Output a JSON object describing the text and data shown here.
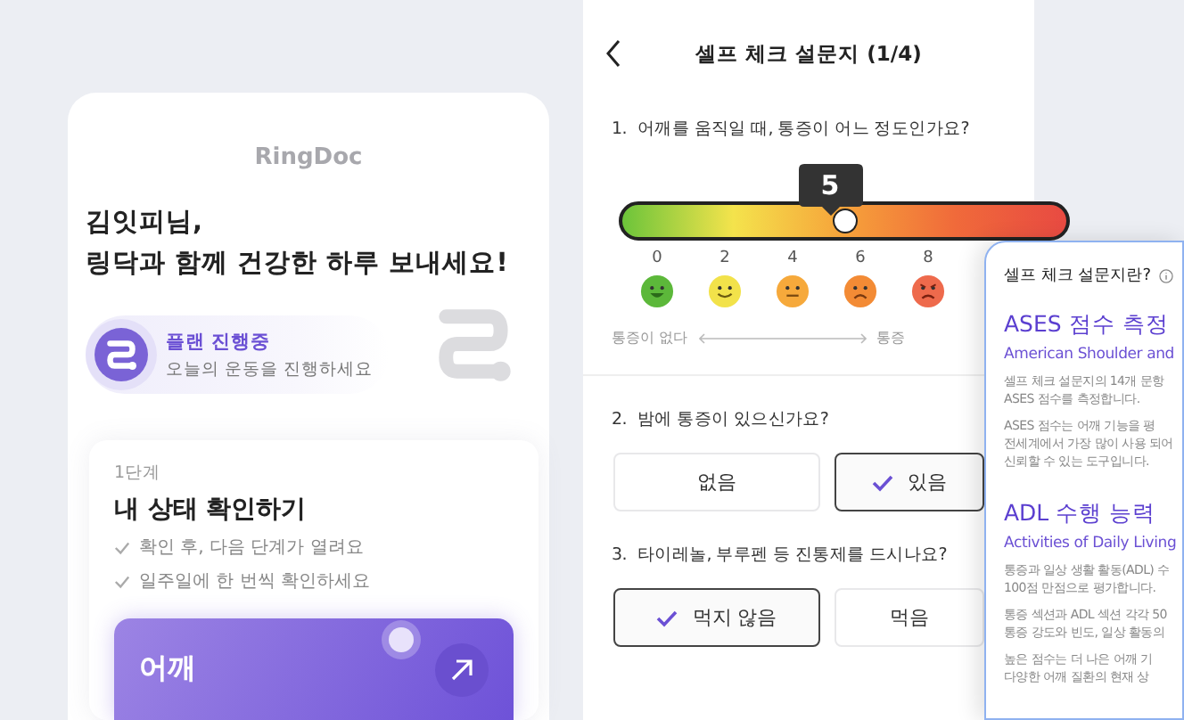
{
  "home": {
    "brand": "RingDoc",
    "greeting": [
      "김잇피님,",
      "링닥과 함께 건강한 하루 보내세요!"
    ],
    "plan": {
      "title": "플랜 진행중",
      "subtitle": "오늘의 운동을 진행하세요"
    },
    "step": {
      "label": "1단계",
      "title": "내 상태 확인하기",
      "checks": [
        "확인 후, 다음 단계가 열려요",
        "일주일에 한 번씩 확인하세요"
      ],
      "body_part": "어깨"
    }
  },
  "survey": {
    "title": "셀프 체크 설문지 (1/4)",
    "questions": [
      {
        "kind": "scale",
        "number": "1.",
        "text": "어깨를 움직일 때, 통증이 어느 정도인가요?",
        "value_label": "5",
        "level": 0.5,
        "min_label": "통증이 없다",
        "max_label": "통증",
        "ticks": [
          {
            "label": "0",
            "kind": "happy",
            "color": "#5cb83a"
          },
          {
            "label": "2",
            "kind": "smile",
            "color": "#f2e24a"
          },
          {
            "label": "4",
            "kind": "neutral",
            "color": "#f6a93b"
          },
          {
            "label": "6",
            "kind": "sad",
            "color": "#f38b35"
          },
          {
            "label": "8",
            "kind": "angry",
            "color": "#ee6a4c"
          }
        ]
      },
      {
        "kind": "choice",
        "number": "2.",
        "text": "밤에 통증이 있으신가요?",
        "options": [
          {
            "label": "없음",
            "selected": false
          },
          {
            "label": "있음",
            "selected": true
          }
        ]
      },
      {
        "kind": "choice",
        "number": "3.",
        "text": "타이레놀, 부루펜 등 진통제를 드시나요?",
        "options": [
          {
            "label": "먹지 않음",
            "selected": true
          },
          {
            "label": "먹음",
            "selected": false
          }
        ]
      }
    ]
  },
  "info": {
    "title": "셀프 체크 설문지란?",
    "sections": [
      {
        "heading": "ASES 점수 측정",
        "subtitle": "American Shoulder and",
        "paragraphs": [
          "셀프 체크 설문지의 14개 문항\nASES 점수를 측정합니다.",
          "ASES 점수는 어깨 기능을 평\n전세계에서 가장 많이 사용 되어\n신뢰할 수 있는 도구입니다."
        ]
      },
      {
        "heading": "ADL 수행 능력",
        "subtitle": "Activities of Daily Living",
        "paragraphs": [
          "통증과 일상 생활 활동(ADL) 수\n100점 만점으로 평가합니다.",
          "통증 섹션과 ADL 섹션 각각 50\n통증 강도와 빈도, 일상 활동의",
          "높은 점수는 더 나은 어깨 기\n다양한 어깨 질환의 현재 상"
        ]
      }
    ]
  }
}
